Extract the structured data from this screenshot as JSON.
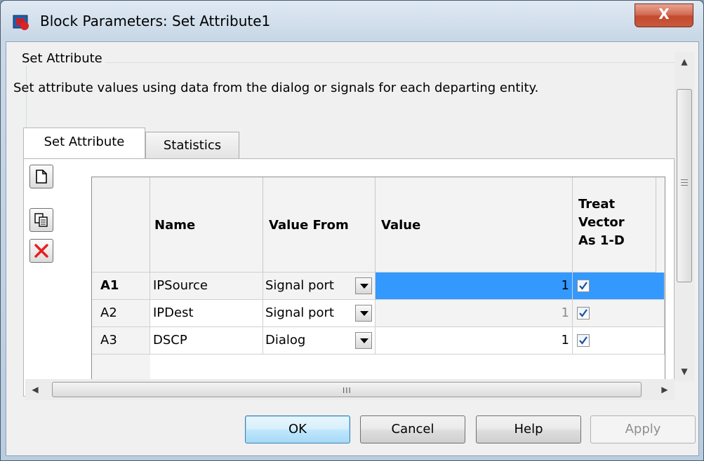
{
  "window": {
    "title": "Block Parameters: Set Attribute1",
    "close_label": "X"
  },
  "group": {
    "label": "Set Attribute",
    "description": "Set attribute values using data from the dialog or signals for each departing entity."
  },
  "tabs": [
    {
      "label": "Set Attribute",
      "active": true
    },
    {
      "label": "Statistics",
      "active": false
    }
  ],
  "tools": {
    "icons": [
      "new-row-icon",
      "copy-row-icon",
      "delete-row-icon"
    ]
  },
  "table": {
    "headers": {
      "name": "Name",
      "value_from": "Value From",
      "value": "Value",
      "treat_line1": "Treat",
      "treat_line2": "Vector",
      "treat_line3": "As 1-D"
    },
    "rows": [
      {
        "id": "A1",
        "name": "IPSource",
        "value_from": "Signal port",
        "value": "1",
        "treat_as_1d": true,
        "selected": true
      },
      {
        "id": "A2",
        "name": "IPDest",
        "value_from": "Signal port",
        "value": "1",
        "treat_as_1d": true,
        "selected": false
      },
      {
        "id": "A3",
        "name": "DSCP",
        "value_from": "Dialog",
        "value": "1",
        "treat_as_1d": true,
        "selected": false
      }
    ]
  },
  "scrollbars": {
    "up_arrow": "▲",
    "down_arrow": "▼",
    "left_arrow": "◀",
    "right_arrow": "▶",
    "h_grip": "III"
  },
  "buttons": {
    "ok": "OK",
    "cancel": "Cancel",
    "help": "Help",
    "apply": "Apply"
  },
  "colors": {
    "selection": "#3399ff",
    "delete_red": "#e81e1e",
    "check_blue": "#1c4f9c"
  }
}
